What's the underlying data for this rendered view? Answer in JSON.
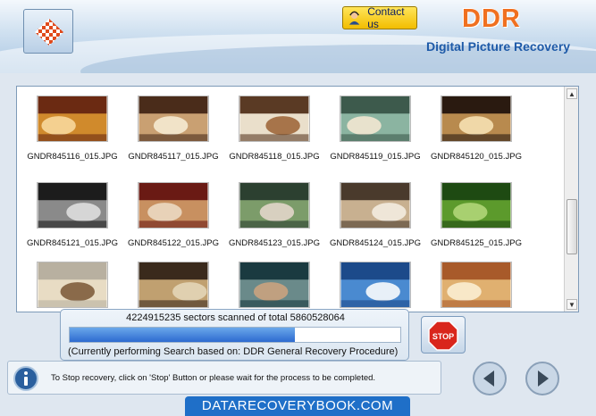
{
  "header": {
    "brand": "DDR",
    "subtitle": "Digital Picture Recovery",
    "contact_label": "Contact us"
  },
  "gallery": {
    "items": [
      {
        "name": "GNDR845116_015.JPG",
        "palette": [
          "#6b2a12",
          "#d08a2c",
          "#f4d090"
        ]
      },
      {
        "name": "GNDR845117_015.JPG",
        "palette": [
          "#4a2c1a",
          "#c9a072",
          "#f1e3c8"
        ]
      },
      {
        "name": "GNDR845118_015.JPG",
        "palette": [
          "#5a3a24",
          "#eadfcb",
          "#a7744a"
        ]
      },
      {
        "name": "GNDR845119_015.JPG",
        "palette": [
          "#3d5a4c",
          "#8bb4a1",
          "#e8e2cd"
        ]
      },
      {
        "name": "GNDR845120_015.JPG",
        "palette": [
          "#2a1a10",
          "#b88a4e",
          "#f0d8a8"
        ]
      },
      {
        "name": "GNDR845121_015.JPG",
        "palette": [
          "#1c1c1c",
          "#8a8a8a",
          "#d6d6d6"
        ]
      },
      {
        "name": "GNDR845122_015.JPG",
        "palette": [
          "#6a1a14",
          "#c89060",
          "#e8d2b8"
        ]
      },
      {
        "name": "GNDR845123_015.JPG",
        "palette": [
          "#2c4030",
          "#7c9c6a",
          "#d8d0c0"
        ]
      },
      {
        "name": "GNDR845124_015.JPG",
        "palette": [
          "#4a3a2c",
          "#c8b090",
          "#efe6d8"
        ]
      },
      {
        "name": "GNDR845125_015.JPG",
        "palette": [
          "#1e4a12",
          "#5c9a2c",
          "#a8d070"
        ]
      },
      {
        "name": "",
        "palette": [
          "#b8b0a0",
          "#e8dcc4",
          "#8a6a4a"
        ]
      },
      {
        "name": "",
        "palette": [
          "#3a2a1c",
          "#c0a070",
          "#e0d0b0"
        ]
      },
      {
        "name": "",
        "palette": [
          "#1a3a40",
          "#6a8a8a",
          "#c0a080"
        ]
      },
      {
        "name": "",
        "palette": [
          "#1c4a8a",
          "#4a8ad0",
          "#e8f0f8"
        ]
      },
      {
        "name": "",
        "palette": [
          "#a85a2a",
          "#e0b070",
          "#f8e8c8"
        ]
      }
    ]
  },
  "progress": {
    "sectors_text": "4224915235 sectors scanned of total 5860528064",
    "fraction": 0.68,
    "method_text": "(Currently performing Search based on:  DDR General Recovery Procedure)"
  },
  "status": {
    "text": "To Stop recovery, click on 'Stop' Button or please wait for the process to be completed."
  },
  "footer": {
    "watermark": "DATARECOVERYBOOK.COM"
  },
  "colors": {
    "brand_orange": "#f07020",
    "subtitle_blue": "#1e5aa8",
    "progress_blue": "#2d6ad0",
    "footer_blue": "#1f6fc8"
  }
}
